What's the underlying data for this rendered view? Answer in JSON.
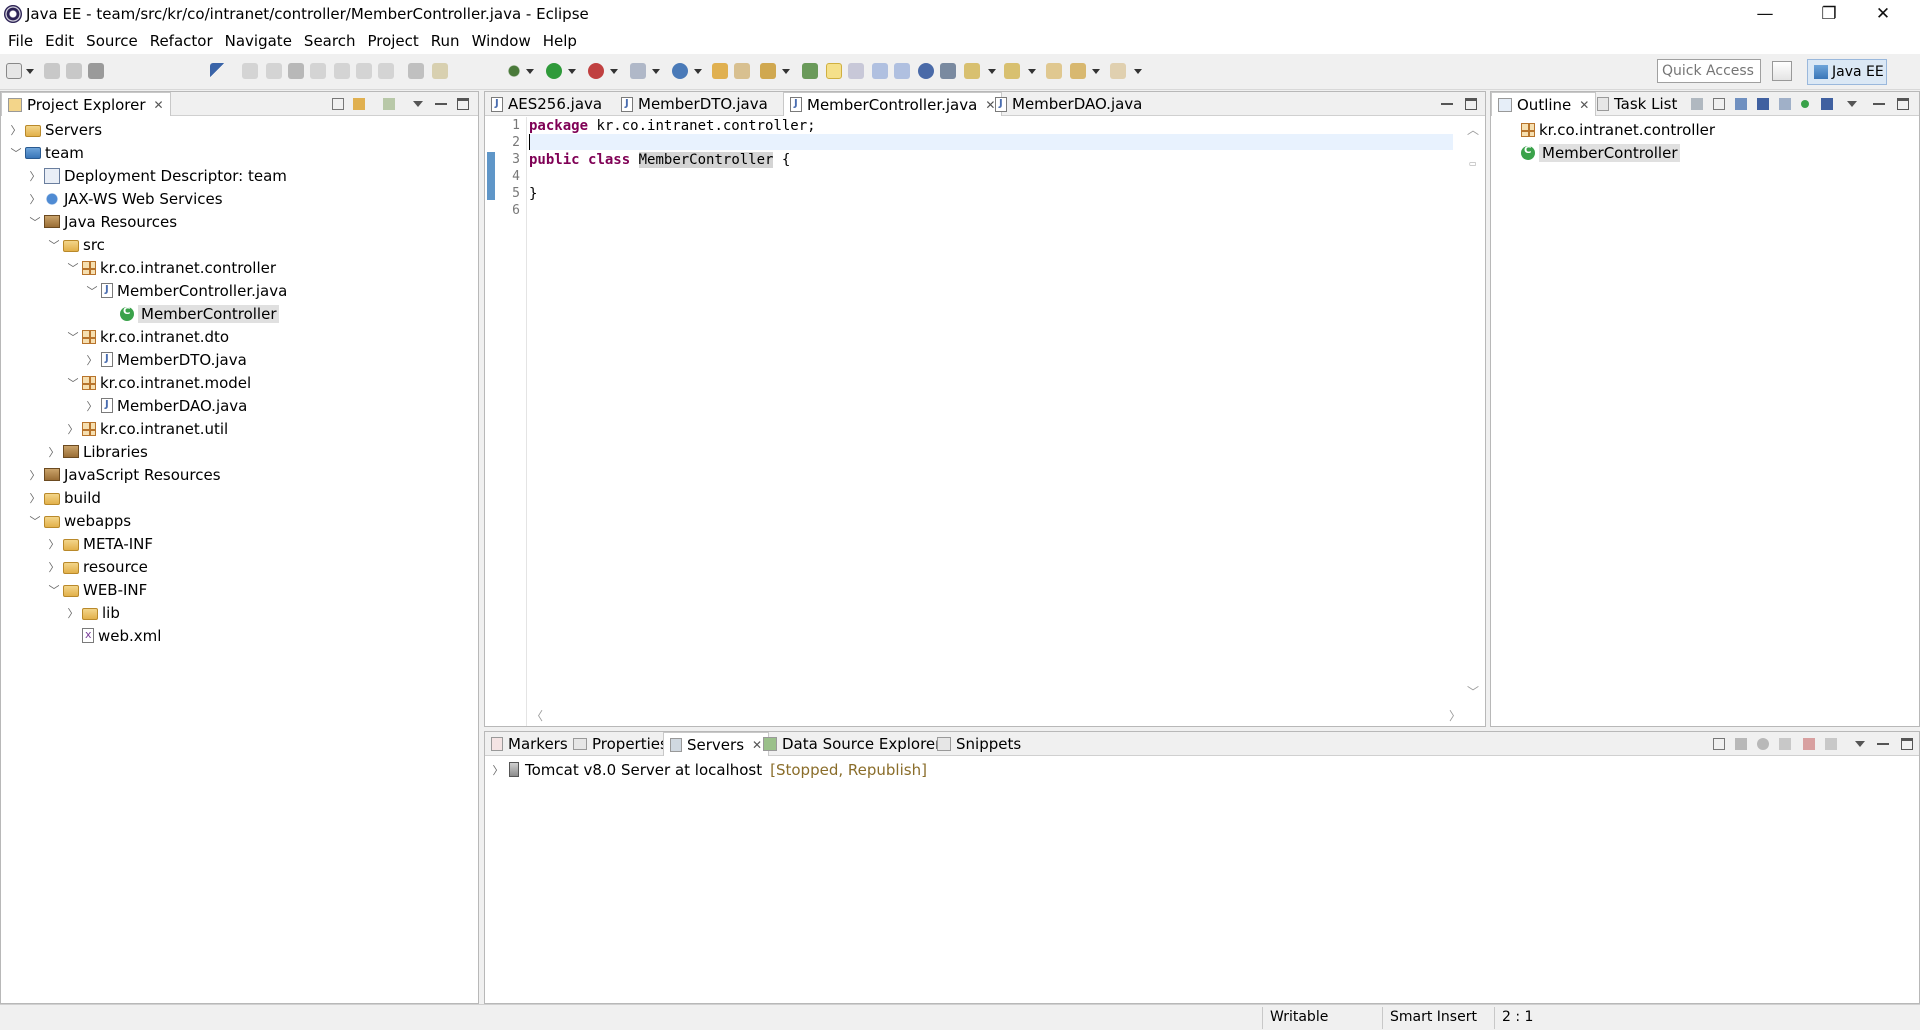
{
  "window": {
    "title": "Java EE - team/src/kr/co/intranet/controller/MemberController.java - Eclipse",
    "minimize": "—",
    "restore": "❐",
    "close": "✕"
  },
  "menu": [
    "File",
    "Edit",
    "Source",
    "Refactor",
    "Navigate",
    "Search",
    "Project",
    "Run",
    "Window",
    "Help"
  ],
  "toolbar": {
    "quick_access_placeholder": "Quick Access",
    "perspective_label": "Java EE"
  },
  "project_explorer": {
    "tab_label": "Project Explorer",
    "tree": [
      {
        "label": "Servers",
        "icon": "folder-icon",
        "depth": 0,
        "expander": "collapsed"
      },
      {
        "label": "team",
        "icon": "project-icon",
        "depth": 0,
        "expander": "expanded"
      },
      {
        "label": "Deployment Descriptor: team",
        "icon": "deployment-descriptor-icon",
        "depth": 1,
        "expander": "collapsed"
      },
      {
        "label": "JAX-WS Web Services",
        "icon": "web-services-icon",
        "depth": 1,
        "expander": "collapsed"
      },
      {
        "label": "Java Resources",
        "icon": "java-resources-icon",
        "depth": 1,
        "expander": "expanded"
      },
      {
        "label": "src",
        "icon": "source-folder-icon",
        "depth": 2,
        "expander": "expanded"
      },
      {
        "label": "kr.co.intranet.controller",
        "icon": "package-icon",
        "depth": 3,
        "expander": "expanded"
      },
      {
        "label": "MemberController.java",
        "icon": "java-file-icon",
        "depth": 4,
        "expander": "expanded"
      },
      {
        "label": "MemberController",
        "icon": "class-icon",
        "depth": 5,
        "expander": "none",
        "selected": true
      },
      {
        "label": "kr.co.intranet.dto",
        "icon": "package-icon",
        "depth": 3,
        "expander": "expanded"
      },
      {
        "label": "MemberDTO.java",
        "icon": "java-file-icon",
        "depth": 4,
        "expander": "collapsed"
      },
      {
        "label": "kr.co.intranet.model",
        "icon": "package-icon",
        "depth": 3,
        "expander": "expanded"
      },
      {
        "label": "MemberDAO.java",
        "icon": "java-file-icon",
        "depth": 4,
        "expander": "collapsed"
      },
      {
        "label": "kr.co.intranet.util",
        "icon": "package-icon",
        "depth": 3,
        "expander": "collapsed"
      },
      {
        "label": "Libraries",
        "icon": "libraries-icon",
        "depth": 2,
        "expander": "collapsed"
      },
      {
        "label": "JavaScript Resources",
        "icon": "javascript-resources-icon",
        "depth": 1,
        "expander": "collapsed"
      },
      {
        "label": "build",
        "icon": "folder-icon",
        "depth": 1,
        "expander": "collapsed"
      },
      {
        "label": "webapps",
        "icon": "folder-icon",
        "depth": 1,
        "expander": "expanded"
      },
      {
        "label": "META-INF",
        "icon": "folder-icon",
        "depth": 2,
        "expander": "collapsed"
      },
      {
        "label": "resource",
        "icon": "folder-icon",
        "depth": 2,
        "expander": "collapsed"
      },
      {
        "label": "WEB-INF",
        "icon": "folder-icon",
        "depth": 2,
        "expander": "expanded"
      },
      {
        "label": "lib",
        "icon": "folder-icon",
        "depth": 3,
        "expander": "collapsed"
      },
      {
        "label": "web.xml",
        "icon": "xml-file-icon",
        "depth": 3,
        "expander": "none"
      }
    ]
  },
  "editor": {
    "tabs": [
      {
        "label": "AES256.java",
        "active": false
      },
      {
        "label": "MemberDTO.java",
        "active": false
      },
      {
        "label": "MemberController.java",
        "active": true
      },
      {
        "label": "MemberDAO.java",
        "active": false
      }
    ],
    "line_numbers": [
      "1",
      "2",
      "3",
      "4",
      "5",
      "6"
    ],
    "code": {
      "l1_kw": "package",
      "l1_rest": " kr.co.intranet.controller;",
      "l3_kw1": "public",
      "l3_kw2": "class",
      "l3_name": "MemberController",
      "l3_rest": " {",
      "l5": "}"
    }
  },
  "outline": {
    "tab_label": "Outline",
    "task_tab_label": "Task List",
    "items": [
      {
        "label": "kr.co.intranet.controller",
        "icon": "package-icon"
      },
      {
        "label": "MemberController",
        "icon": "class-icon",
        "selected": true
      }
    ]
  },
  "bottom_panel": {
    "tabs": [
      {
        "label": "Markers",
        "active": false
      },
      {
        "label": "Properties",
        "active": false
      },
      {
        "label": "Servers",
        "active": true
      },
      {
        "label": "Data Source Explorer",
        "active": false
      },
      {
        "label": "Snippets",
        "active": false
      }
    ],
    "server_name": "Tomcat v8.0 Server at localhost",
    "server_status": "[Stopped, Republish]"
  },
  "status": {
    "writable": "Writable",
    "insert_mode": "Smart Insert",
    "position": "2 : 1"
  },
  "colors": {
    "keyword": "#7f0055",
    "server_status": "#8a6d2a",
    "selection": "#e0e0e0",
    "current_line": "#e8f2fe",
    "perspective_active": "#dbe8f5"
  }
}
